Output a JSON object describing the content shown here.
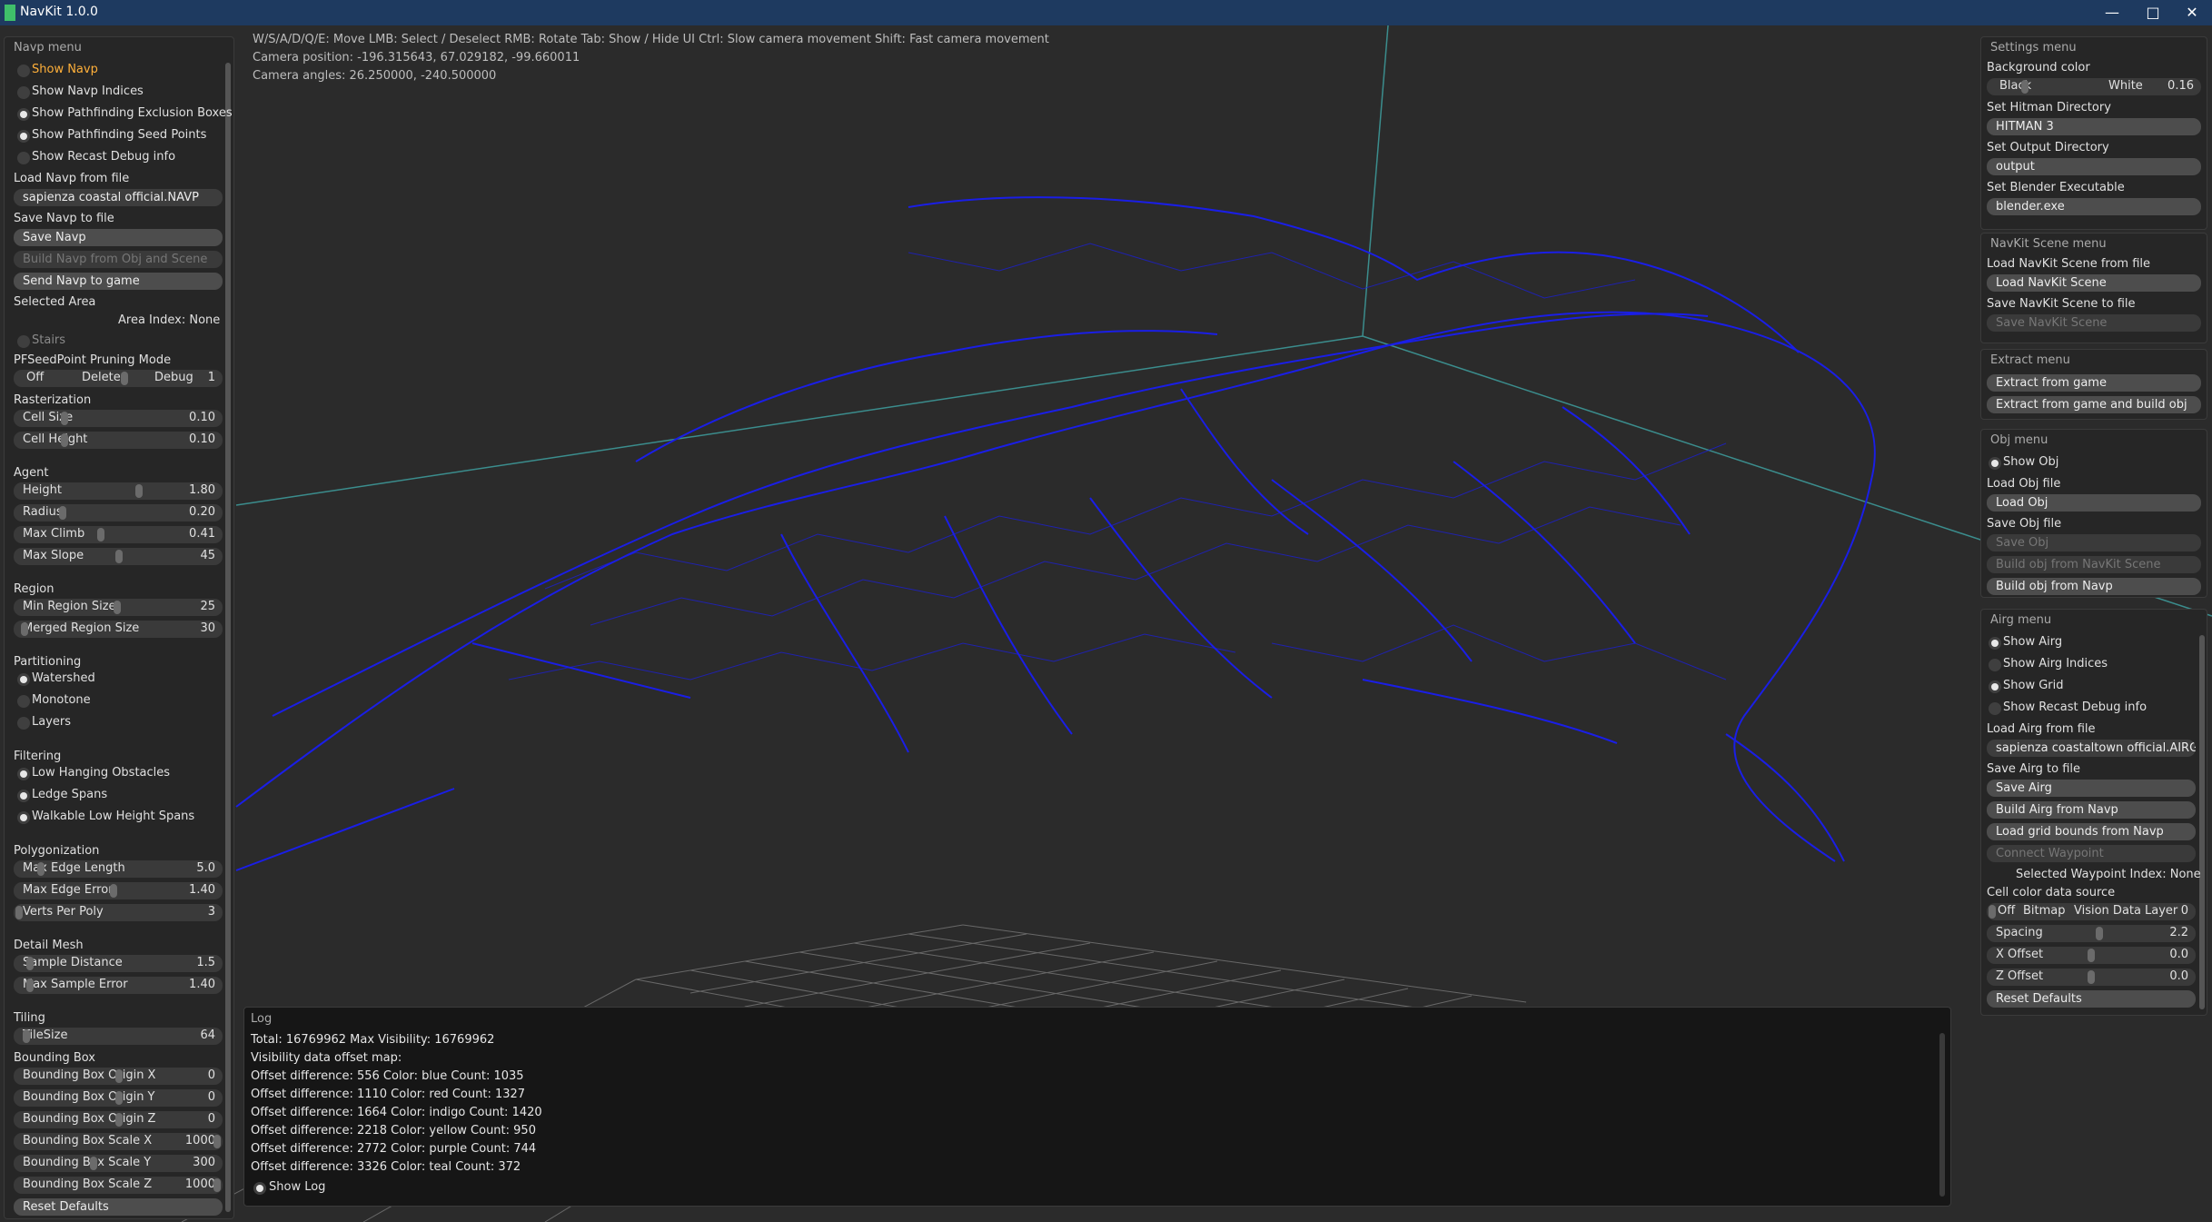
{
  "window": {
    "title": "NavKit 1.0.0"
  },
  "colors": {
    "titlebar": "#1e3a60",
    "wireframe": "#1a1ee6",
    "background": "#2b2b2b",
    "highlight": "#ffb03a"
  },
  "viewport": {
    "help": "W/S/A/D/Q/E: Move  LMB: Select / Deselect RMB: Rotate  Tab: Show / Hide UI  Ctrl: Slow camera movement  Shift: Fast camera movement",
    "camera_position": "Camera position: -196.315643, 67.029182, -99.660011",
    "camera_angles": "Camera angles: 26.250000, -240.500000"
  },
  "navp": {
    "title": "Navp menu",
    "show_navp": "Show Navp",
    "show_navp_indices": "Show Navp Indices",
    "show_excl": "Show Pathfinding Exclusion Boxes",
    "show_seed": "Show Pathfinding Seed Points",
    "show_recast": "Show Recast Debug info",
    "load_label": "Load Navp from file",
    "load_file": "sapienza coastal official.NAVP",
    "save_label": "Save Navp to file",
    "save_btn": "Save Navp",
    "build_btn": "Build Navp from Obj and Scene",
    "send_btn": "Send Navp to game",
    "selected_area": "Selected Area",
    "area_index": "Area Index: None",
    "stairs": "Stairs",
    "pruning_title": "PFSeedPoint Pruning Mode",
    "pruning_off": "Off",
    "pruning_delete": "Delete",
    "pruning_debug": "Debug",
    "pruning_val": "1",
    "rasterization": "Rasterization",
    "cell_size": "Cell Size",
    "cell_size_v": "0.10",
    "cell_height": "Cell Height",
    "cell_height_v": "0.10",
    "agent": "Agent",
    "height": "Height",
    "height_v": "1.80",
    "radius": "Radius",
    "radius_v": "0.20",
    "max_climb": "Max Climb",
    "max_climb_v": "0.41",
    "max_slope": "Max Slope",
    "max_slope_v": "45",
    "region": "Region",
    "min_region": "Min Region Size",
    "min_region_v": "25",
    "merged_region": "Merged Region Size",
    "merged_region_v": "30",
    "partitioning": "Partitioning",
    "watershed": "Watershed",
    "monotone": "Monotone",
    "layers": "Layers",
    "filtering": "Filtering",
    "low_hanging": "Low Hanging Obstacles",
    "ledge": "Ledge Spans",
    "walkable": "Walkable Low Height Spans",
    "polygonization": "Polygonization",
    "max_edge_len": "Max Edge Length",
    "max_edge_len_v": "5.0",
    "max_edge_err": "Max Edge Error",
    "max_edge_err_v": "1.40",
    "verts_per_poly": "Verts Per Poly",
    "verts_per_poly_v": "3",
    "detail_mesh": "Detail Mesh",
    "sample_dist": "Sample Distance",
    "sample_dist_v": "1.5",
    "max_sample_err": "Max Sample Error",
    "max_sample_err_v": "1.40",
    "tiling": "Tiling",
    "tile_size": "TileSize",
    "tile_size_v": "64",
    "bbox": "Bounding Box",
    "bbox_ox": "Bounding Box Origin X",
    "bbox_ox_v": "0",
    "bbox_oy": "Bounding Box Origin Y",
    "bbox_oy_v": "0",
    "bbox_oz": "Bounding Box Origin Z",
    "bbox_oz_v": "0",
    "bbox_sx": "Bounding Box Scale X",
    "bbox_sx_v": "1000",
    "bbox_sy": "Bounding Box Scale Y",
    "bbox_sy_v": "300",
    "bbox_sz": "Bounding Box Scale Z",
    "bbox_sz_v": "1000",
    "reset": "Reset Defaults"
  },
  "settings": {
    "title": "Settings menu",
    "bg_label": "Background color",
    "black": "Black",
    "white": "White",
    "bg_val": "0.16",
    "hitman_label": "Set Hitman Directory",
    "hitman_val": "HITMAN 3",
    "output_label": "Set Output Directory",
    "output_val": "output",
    "blender_label": "Set Blender Executable",
    "blender_val": "blender.exe"
  },
  "scene": {
    "title": "NavKit Scene menu",
    "load_label": "Load NavKit Scene from file",
    "load_btn": "Load NavKit Scene",
    "save_label": "Save NavKit Scene to file",
    "save_btn": "Save NavKit Scene"
  },
  "extract": {
    "title": "Extract menu",
    "extract_btn": "Extract from game",
    "extract_build_btn": "Extract from game and build obj"
  },
  "obj": {
    "title": "Obj menu",
    "show_obj": "Show Obj",
    "load_label": "Load Obj file",
    "load_btn": "Load Obj",
    "save_label": "Save Obj file",
    "save_btn": "Save Obj",
    "build_scene_btn": "Build obj from NavKit Scene",
    "build_navp_btn": "Build obj from Navp"
  },
  "airg": {
    "title": "Airg menu",
    "show_airg": "Show Airg",
    "show_airg_indices": "Show Airg Indices",
    "show_grid": "Show Grid",
    "show_recast": "Show Recast Debug info",
    "load_label": "Load Airg from file",
    "load_file": "sapienza coastaltown official.AIRG",
    "save_label": "Save Airg to file",
    "save_btn": "Save Airg",
    "build_btn": "Build Airg from Navp",
    "grid_bounds_btn": "Load grid bounds from Navp",
    "connect_btn": "Connect Waypoint",
    "selected_wp": "Selected Waypoint Index: None",
    "cell_color_label": "Cell color data source",
    "cc_off": "Off",
    "cc_bitmap": "Bitmap",
    "cc_vision": "Vision Data",
    "cc_layer": "Layer",
    "cc_layer_v": "0",
    "spacing": "Spacing",
    "spacing_v": "2.2",
    "x_offset": "X Offset",
    "x_offset_v": "0.0",
    "z_offset": "Z Offset",
    "z_offset_v": "0.0",
    "reset": "Reset Defaults"
  },
  "log": {
    "title": "Log",
    "lines": [
      "Total: 16769962 Max Visibility: 16769962",
      "Visibility data offset map:",
      "Offset difference: 556 Color: blue Count: 1035",
      "Offset difference: 1110 Color: red Count: 1327",
      "Offset difference: 1664 Color: indigo Count: 1420",
      "Offset difference: 2218 Color: yellow Count: 950",
      "Offset difference: 2772 Color: purple Count: 744",
      "Offset difference: 3326 Color: teal Count: 372"
    ],
    "show_log": "Show Log"
  }
}
